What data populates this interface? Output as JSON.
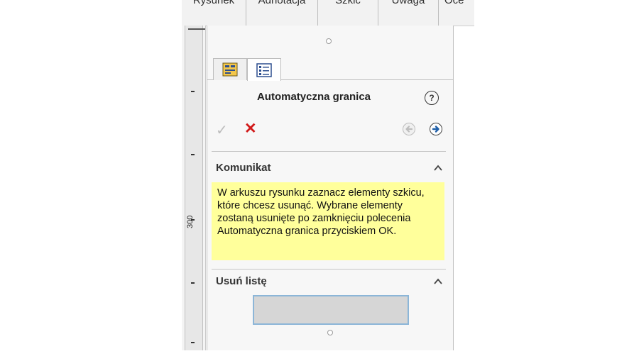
{
  "ribbon_tabs": [
    "Rysunek",
    "Adnotacja",
    "Szkic",
    "Uwaga",
    "Oce"
  ],
  "ruler": {
    "label": "300"
  },
  "panel": {
    "tabs": [
      {
        "name": "feature-tree-tab",
        "icon": "tree-icon"
      },
      {
        "name": "property-tab",
        "icon": "property-manager-icon"
      }
    ],
    "title": "Automatyczna granica",
    "help_glyph": "?",
    "ok_glyph": "✓",
    "cancel_glyph": "✕",
    "message_section": {
      "title": "Komunikat",
      "text": "W arkuszu rysunku zaznacz elementy szkicu, które chcesz usunąć. Wybrane elementy zostaną usunięte po zamknięciu polecenia Automatyczna granica przyciskiem OK."
    },
    "remove_section": {
      "title": "Usuń listę"
    }
  },
  "colors": {
    "message_bg": "#ffff9b",
    "cancel": "#d11a1a",
    "forward_arrow": "#1f5fa8"
  }
}
